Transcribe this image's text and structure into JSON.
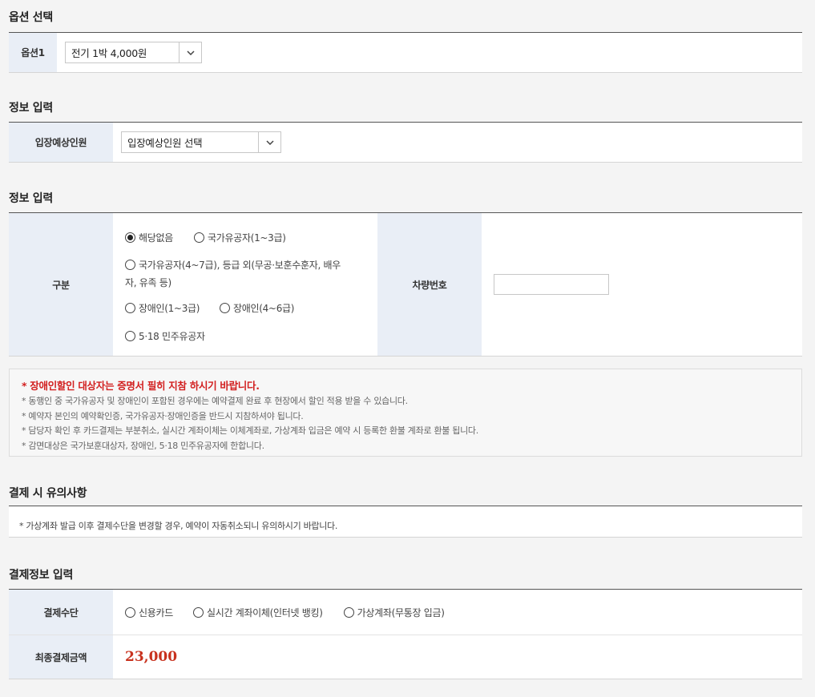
{
  "option_section": {
    "title": "옵션 선택",
    "label": "옵션1",
    "selected": "전기 1박 4,000원"
  },
  "people_section": {
    "title": "정보 입력",
    "label": "입장예상인원",
    "selected": "입장예상인원 선택"
  },
  "info_section": {
    "title": "정보 입력",
    "category_label": "구분",
    "options": [
      {
        "label": "해당없음",
        "checked": true
      },
      {
        "label": "국가유공자(1~3급)",
        "checked": false
      },
      {
        "label": "국가유공자(4~7급), 등급 외(무공·보훈수훈자, 배우",
        "label_cont": "자, 유족 등)",
        "checked": false
      },
      {
        "label": "장애인(1~3급)",
        "checked": false
      },
      {
        "label": "장애인(4~6급)",
        "checked": false
      },
      {
        "label": "5·18 민주유공자",
        "checked": false
      }
    ],
    "car_label": "차량번호",
    "car_value": ""
  },
  "notice": {
    "warning": "* 장애인할인 대상자는 증명서 필히 지참 하시기 바랍니다.",
    "lines": [
      "* 동행인 중 국가유공자 및 장애인이 포함된 경우에는 예약결제 완료 후 현장에서 할인 적용 받을 수 있습니다.",
      "* 예약자 본인의 예약확인증, 국가유공자·장애인증을 반드시 지참하셔야 됩니다.",
      "* 담당자 확인 후 카드결제는 부분취소, 실시간 계좌이체는 이체계좌로, 가상계좌 입금은 예약 시 등록한 환불 계좌로 환불 됩니다.",
      "* 감면대상은 국가보훈대상자, 장애인, 5·18 민주유공자에 한합니다."
    ]
  },
  "payment_notice": {
    "title": "결제 시 유의사항",
    "text": "* 가상계좌 발급 이후 결제수단을 변경할 경우, 예약이 자동취소되니 유의하시기 바랍니다."
  },
  "payment": {
    "title": "결제정보 입력",
    "method_label": "결제수단",
    "methods": [
      "신용카드",
      "실시간 계좌이체(인터넷 뱅킹)",
      "가상계좌(무통장 입금)"
    ],
    "amount_label": "최종결제금액",
    "amount": "23,000"
  }
}
